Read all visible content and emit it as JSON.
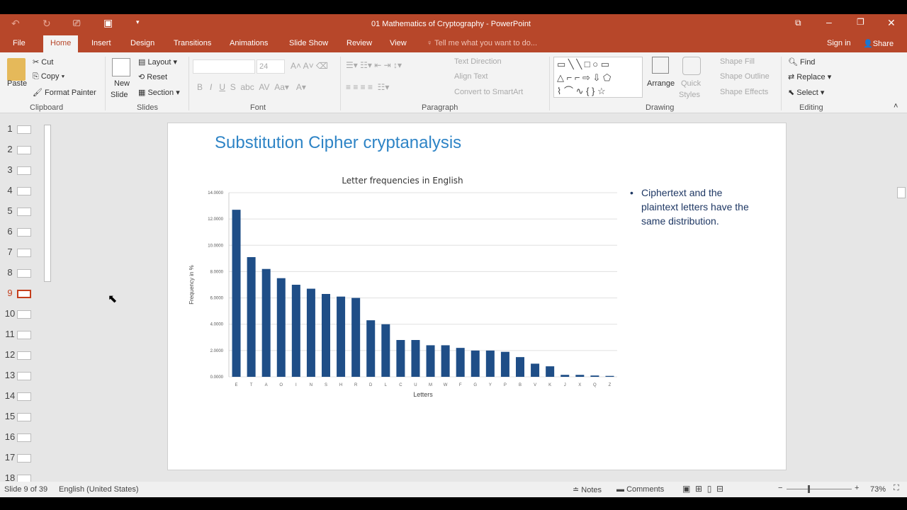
{
  "window": {
    "title": "01 Mathematics of Cryptography - PowerPoint",
    "sign_in": "Sign in",
    "share": "Share"
  },
  "tabs": [
    "File",
    "Home",
    "Insert",
    "Design",
    "Transitions",
    "Animations",
    "Slide Show",
    "Review",
    "View"
  ],
  "tell_me": "Tell me what you want to do...",
  "ribbon": {
    "clipboard": {
      "paste": "Paste",
      "cut": "Cut",
      "copy": "Copy",
      "format_painter": "Format Painter",
      "label": "Clipboard"
    },
    "slides": {
      "new_slide": "New",
      "new_slide2": "Slide",
      "layout": "Layout",
      "reset": "Reset",
      "section": "Section",
      "label": "Slides"
    },
    "font": {
      "size": "24",
      "label": "Font"
    },
    "paragraph": {
      "text_direction": "Text Direction",
      "align_text": "Align Text",
      "convert": "Convert to SmartArt",
      "label": "Paragraph"
    },
    "drawing": {
      "arrange": "Arrange",
      "quick": "Quick",
      "styles": "Styles",
      "shape_fill": "Shape Fill",
      "shape_outline": "Shape Outline",
      "shape_effects": "Shape Effects",
      "label": "Drawing"
    },
    "editing": {
      "find": "Find",
      "replace": "Replace",
      "select": "Select",
      "label": "Editing"
    }
  },
  "thumbnails": [
    "1",
    "2",
    "3",
    "4",
    "5",
    "6",
    "7",
    "8",
    "9",
    "10",
    "11",
    "12",
    "13",
    "14",
    "15",
    "16",
    "17",
    "18"
  ],
  "active_slide": 9,
  "slide": {
    "title": "Substitution Cipher cryptanalysis",
    "bullet": "Ciphertext and the plaintext letters have the same distribution."
  },
  "chart_data": {
    "type": "bar",
    "title": "Letter frequencies in English",
    "xlabel": "Letters",
    "ylabel": "Frequency in %",
    "ylim": [
      0,
      14
    ],
    "yticks": [
      "0.0000",
      "2.0000",
      "4.0000",
      "6.0000",
      "8.0000",
      "10.0000",
      "12.0000",
      "14.0000"
    ],
    "categories": [
      "E",
      "T",
      "A",
      "O",
      "I",
      "N",
      "S",
      "H",
      "R",
      "D",
      "L",
      "C",
      "U",
      "M",
      "W",
      "F",
      "G",
      "Y",
      "P",
      "B",
      "V",
      "K",
      "J",
      "X",
      "Q",
      "Z"
    ],
    "values": [
      12.7,
      9.1,
      8.2,
      7.5,
      7.0,
      6.7,
      6.3,
      6.1,
      6.0,
      4.3,
      4.0,
      2.8,
      2.8,
      2.4,
      2.4,
      2.2,
      2.0,
      2.0,
      1.9,
      1.5,
      1.0,
      0.8,
      0.15,
      0.15,
      0.1,
      0.07
    ],
    "color": "#1f4e87",
    "grid": true
  },
  "status": {
    "slide_info": "Slide 9 of 39",
    "language": "English (United States)",
    "notes": "Notes",
    "comments": "Comments",
    "zoom": "73%"
  }
}
